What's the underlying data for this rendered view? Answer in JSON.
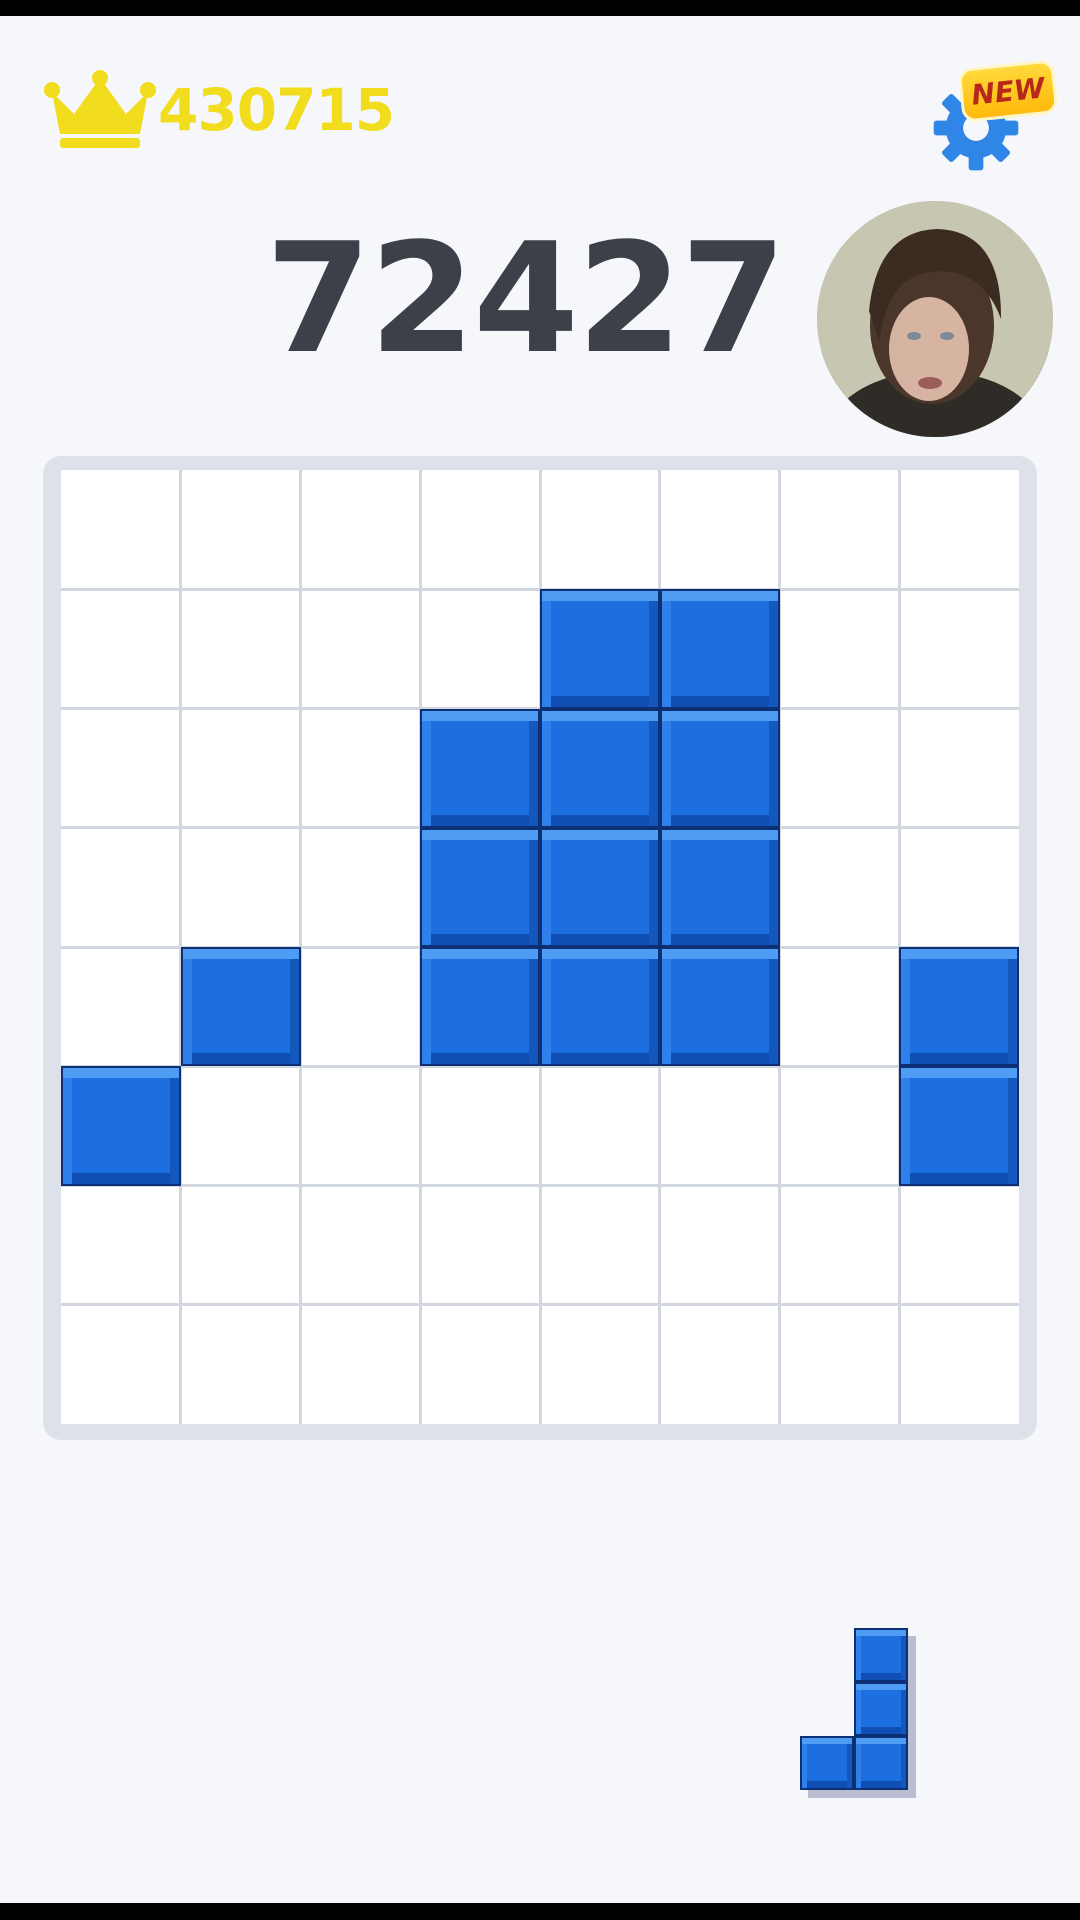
{
  "header": {
    "best_score": "430715",
    "current_score": "72427",
    "new_badge": "NEW",
    "icons": {
      "best": "crown-icon",
      "settings": "gear-icon",
      "player": "player-avatar"
    }
  },
  "board": {
    "rows": 8,
    "cols": 8,
    "filled_cells": [
      [
        1,
        4
      ],
      [
        1,
        5
      ],
      [
        2,
        3
      ],
      [
        2,
        4
      ],
      [
        2,
        5
      ],
      [
        3,
        3
      ],
      [
        3,
        4
      ],
      [
        3,
        5
      ],
      [
        4,
        1
      ],
      [
        4,
        3
      ],
      [
        4,
        4
      ],
      [
        4,
        5
      ],
      [
        4,
        7
      ],
      [
        5,
        0
      ],
      [
        5,
        7
      ]
    ]
  },
  "tray": {
    "pieces": [
      {
        "name": "j-piece",
        "cells": [
          [
            0,
            1
          ],
          [
            1,
            1
          ],
          [
            2,
            0
          ],
          [
            2,
            1
          ]
        ]
      }
    ]
  },
  "colors": {
    "block": "#1d6fdf",
    "best_score": "#f2dc1e",
    "score": "#3d4049",
    "settings": "#2f86e6",
    "badge": "#ffc51f"
  }
}
